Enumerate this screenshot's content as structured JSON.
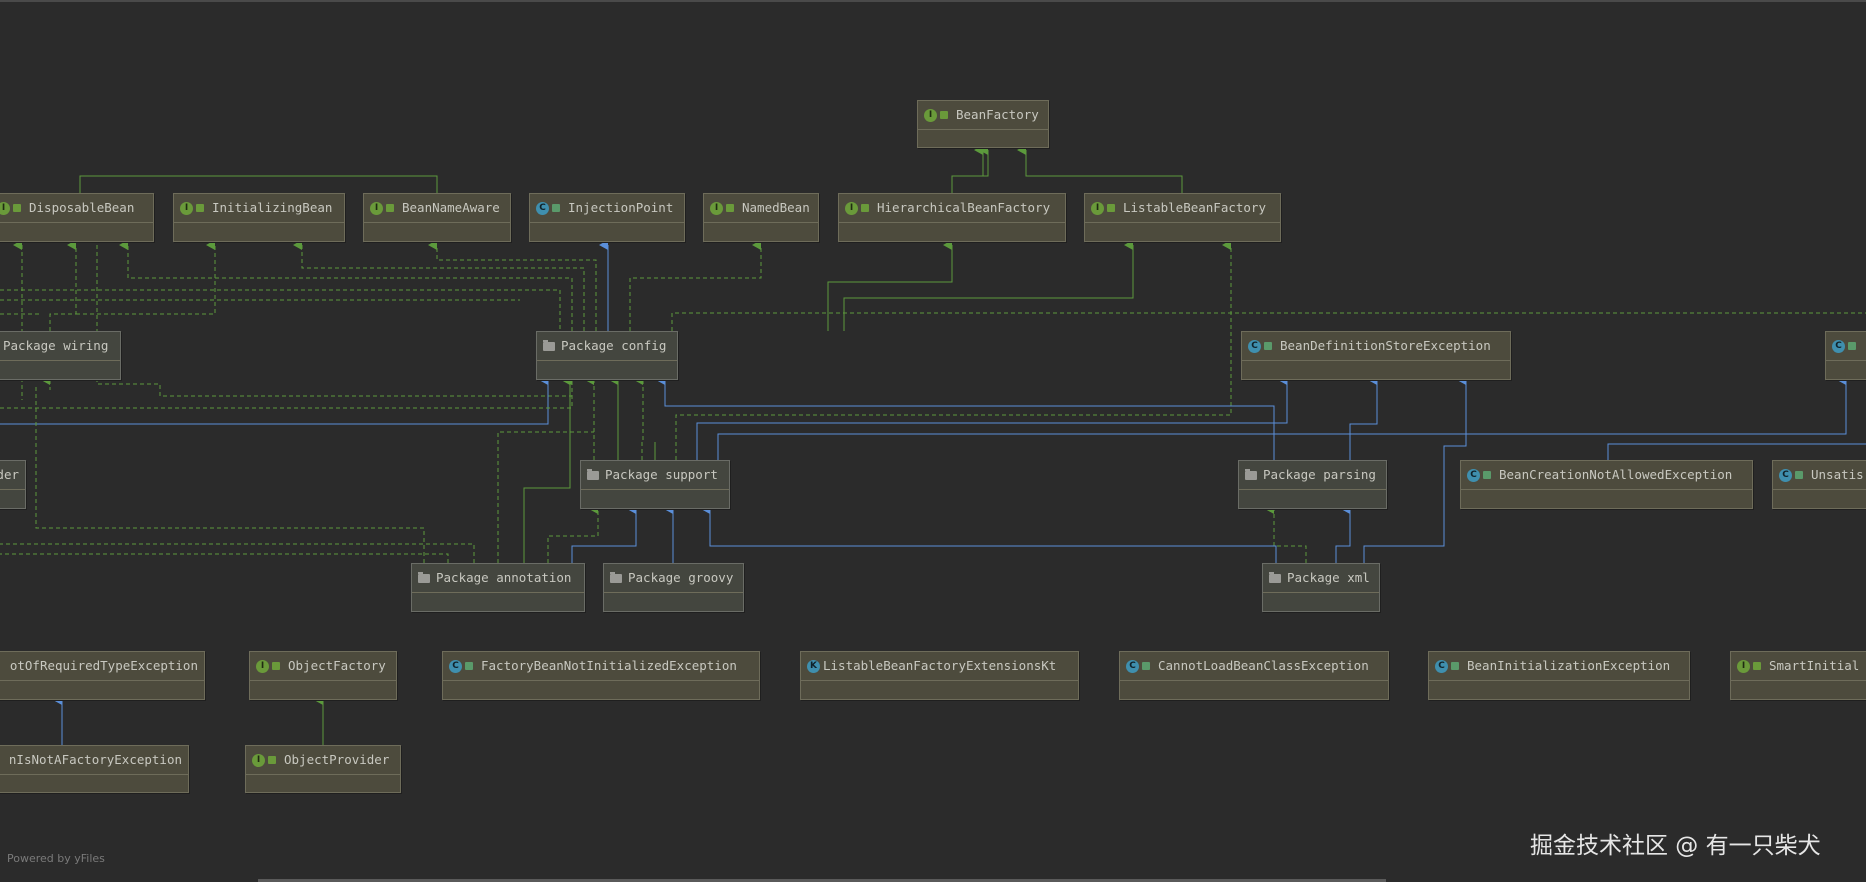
{
  "diagram": {
    "colors": {
      "background": "#2b2b2b",
      "interface_node": "#4d4b3d",
      "package_node": "#44463f",
      "inheritance_edge": "#5c9a3c",
      "dependency_edge": "#5b8fd9",
      "text": "#c8c8c0"
    },
    "nodes": [
      {
        "id": "BeanFactory",
        "label": "BeanFactory",
        "kind": "interface"
      },
      {
        "id": "DisposableBean",
        "label": "DisposableBean",
        "kind": "interface"
      },
      {
        "id": "InitializingBean",
        "label": "InitializingBean",
        "kind": "interface"
      },
      {
        "id": "BeanNameAware",
        "label": "BeanNameAware",
        "kind": "interface"
      },
      {
        "id": "InjectionPoint",
        "label": "InjectionPoint",
        "kind": "class"
      },
      {
        "id": "NamedBean",
        "label": "NamedBean",
        "kind": "interface"
      },
      {
        "id": "HierarchicalBeanFactory",
        "label": "HierarchicalBeanFactory",
        "kind": "interface"
      },
      {
        "id": "ListableBeanFactory",
        "label": "ListableBeanFactory",
        "kind": "interface"
      },
      {
        "id": "PackageWiring",
        "label": "Package wiring",
        "kind": "package"
      },
      {
        "id": "PackageConfig",
        "label": "Package config",
        "kind": "package"
      },
      {
        "id": "BeanDefinitionStoreException",
        "label": "BeanDefinitionStoreException",
        "kind": "class"
      },
      {
        "id": "RightEdgeClass",
        "label": "",
        "kind": "class"
      },
      {
        "id": "LeftEdgeNode",
        "label": "der",
        "kind": "package"
      },
      {
        "id": "PackageSupport",
        "label": "Package support",
        "kind": "package"
      },
      {
        "id": "PackageParsing",
        "label": "Package parsing",
        "kind": "package"
      },
      {
        "id": "BeanCreationNotAllowedException",
        "label": "BeanCreationNotAllowedException",
        "kind": "class"
      },
      {
        "id": "Unsatis",
        "label": "Unsatis",
        "kind": "class"
      },
      {
        "id": "PackageAnnotation",
        "label": "Package annotation",
        "kind": "package"
      },
      {
        "id": "PackageGroovy",
        "label": "Package groovy",
        "kind": "package"
      },
      {
        "id": "PackageXml",
        "label": "Package xml",
        "kind": "package"
      },
      {
        "id": "NotOfRequiredType",
        "label": "otOfRequiredTypeException",
        "kind": "class"
      },
      {
        "id": "ObjectFactory",
        "label": "ObjectFactory",
        "kind": "interface"
      },
      {
        "id": "FactoryBeanNotInitializedException",
        "label": "FactoryBeanNotInitializedException",
        "kind": "class"
      },
      {
        "id": "ListableBeanFactoryExtensionsKt",
        "label": "ListableBeanFactoryExtensionsKt",
        "kind": "file"
      },
      {
        "id": "CannotLoadBeanClassException",
        "label": "CannotLoadBeanClassException",
        "kind": "class"
      },
      {
        "id": "BeanInitializationException",
        "label": "BeanInitializationException",
        "kind": "class"
      },
      {
        "id": "SmartInitial",
        "label": "SmartInitial",
        "kind": "interface"
      },
      {
        "id": "IsNotAFactory",
        "label": "nIsNotAFactoryException",
        "kind": "class"
      },
      {
        "id": "ObjectProvider",
        "label": "ObjectProvider",
        "kind": "interface"
      }
    ],
    "edges": [
      {
        "from": "HierarchicalBeanFactory",
        "to": "BeanFactory",
        "type": "inheritance"
      },
      {
        "from": "ListableBeanFactory",
        "to": "BeanFactory",
        "type": "inheritance"
      },
      {
        "from": "PackageConfig",
        "to": "HierarchicalBeanFactory",
        "type": "inheritance"
      },
      {
        "from": "PackageConfig",
        "to": "ListableBeanFactory",
        "type": "inheritance"
      },
      {
        "from": "PackageConfig",
        "to": "InjectionPoint",
        "type": "dependency"
      },
      {
        "from": "PackageConfig",
        "to": "NamedBean",
        "type": "realization"
      },
      {
        "from": "PackageConfig",
        "to": "BeanNameAware",
        "type": "realization"
      },
      {
        "from": "PackageConfig",
        "to": "InitializingBean",
        "type": "realization"
      },
      {
        "from": "PackageConfig",
        "to": "DisposableBean",
        "type": "realization"
      },
      {
        "from": "PackageWiring",
        "to": "DisposableBean",
        "type": "realization"
      },
      {
        "from": "PackageWiring",
        "to": "InitializingBean",
        "type": "realization"
      },
      {
        "from": "PackageSupport",
        "to": "PackageConfig",
        "type": "realization"
      },
      {
        "from": "PackageSupport",
        "to": "ListableBeanFactory",
        "type": "realization"
      },
      {
        "from": "PackageSupport",
        "to": "BeanDefinitionStoreException",
        "type": "dependency"
      },
      {
        "from": "PackageParsing",
        "to": "BeanDefinitionStoreException",
        "type": "dependency"
      },
      {
        "from": "PackageXml",
        "to": "BeanDefinitionStoreException",
        "type": "dependency"
      },
      {
        "from": "PackageXml",
        "to": "PackageParsing",
        "type": "dependency"
      },
      {
        "from": "PackageXml",
        "to": "PackageSupport",
        "type": "dependency"
      },
      {
        "from": "PackageAnnotation",
        "to": "PackageSupport",
        "type": "dependency"
      },
      {
        "from": "PackageAnnotation",
        "to": "PackageConfig",
        "type": "realization"
      },
      {
        "from": "PackageGroovy",
        "to": "PackageSupport",
        "type": "dependency"
      },
      {
        "from": "IsNotAFactory",
        "to": "NotOfRequiredType",
        "type": "dependency"
      },
      {
        "from": "ObjectProvider",
        "to": "ObjectFactory",
        "type": "inheritance"
      },
      {
        "from": "BeanCreationNotAllowedException",
        "to": "RightEdgeClass",
        "type": "dependency"
      }
    ]
  },
  "footer": {
    "powered_by": "Powered by yFiles",
    "watermark": "掘金技术社区 @ 有一只柴犬"
  }
}
